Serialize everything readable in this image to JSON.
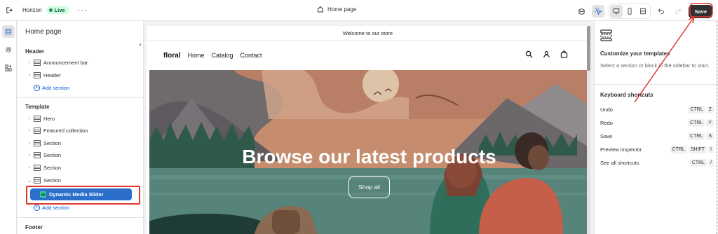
{
  "topbar": {
    "theme_name": "Horizon",
    "status_badge": "Live",
    "page_selector": "Home page",
    "save_label": "Save"
  },
  "sidebar": {
    "title": "Home page",
    "groups": {
      "header": {
        "title": "Header",
        "items": [
          "Announcement bar",
          "Header"
        ],
        "add_label": "Add section"
      },
      "template": {
        "title": "Template",
        "items": [
          "Hero",
          "Featured collection",
          "Section",
          "Section",
          "Section",
          "Section"
        ],
        "selected_block": "Dynamic Media Slider",
        "add_label": "Add section"
      },
      "footer": {
        "title": "Footer"
      }
    }
  },
  "preview": {
    "announcement": "Welcome to our store",
    "logo": "floral",
    "nav": [
      "Home",
      "Catalog",
      "Contact"
    ],
    "hero_title": "Browse our latest products",
    "hero_button": "Shop all"
  },
  "rpanel": {
    "title": "Customize your templates",
    "description": "Select a section or block in the sidebar to start.",
    "shortcuts_title": "Keyboard shortcuts",
    "shortcuts": [
      {
        "label": "Undo",
        "keys": [
          "CTRL",
          "Z"
        ]
      },
      {
        "label": "Redo",
        "keys": [
          "CTRL",
          "Y"
        ]
      },
      {
        "label": "Save",
        "keys": [
          "CTRL",
          "S"
        ]
      },
      {
        "label": "Preview inspector",
        "keys": [
          "CTRL",
          "SHIFT",
          "I"
        ]
      },
      {
        "label": "See all shortcuts",
        "keys": [
          "CTRL",
          "/"
        ]
      }
    ]
  },
  "colors": {
    "accent_blue": "#2c6ecb",
    "link_blue": "#005bd3",
    "annotation_red": "#e0392b",
    "live_green": "#29845a",
    "save_dark": "#303030"
  },
  "icons": [
    "exit-icon",
    "more-icon",
    "home-icon",
    "store-icon",
    "inspector-icon",
    "desktop-icon",
    "mobile-icon",
    "fullwidth-icon",
    "undo-icon",
    "redo-icon",
    "sections-icon",
    "settings-icon",
    "apps-icon",
    "search-icon",
    "account-icon",
    "cart-icon"
  ]
}
